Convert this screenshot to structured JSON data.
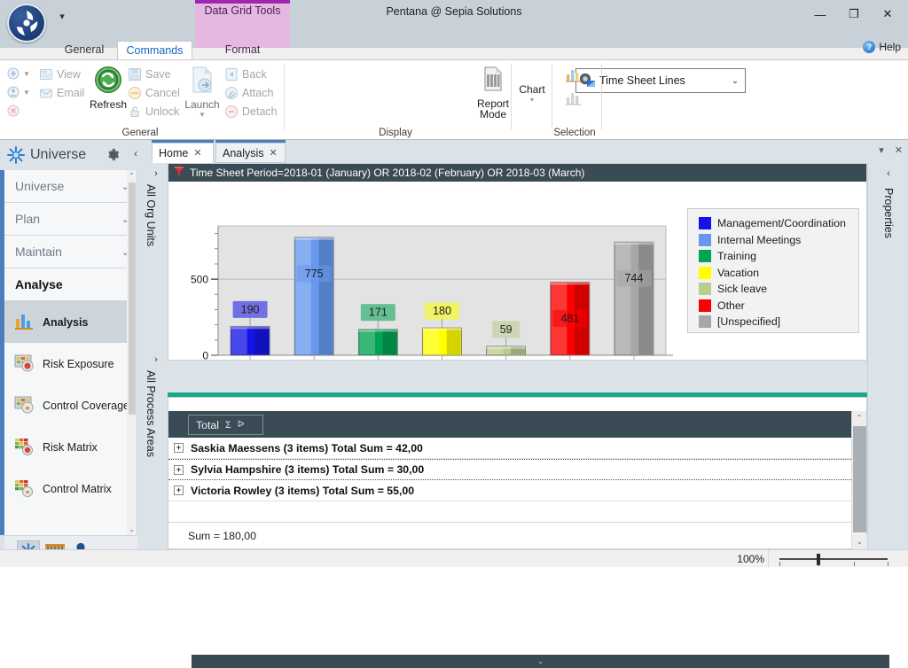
{
  "window": {
    "title": "Pentana @ Sepia Solutions",
    "minimize": "—",
    "maximize": "❐",
    "close": "✕",
    "orb_caret": "▾"
  },
  "ribbon": {
    "contextual_tab": "Data Grid Tools",
    "tabs": [
      {
        "label": "General",
        "selected": false
      },
      {
        "label": "Commands",
        "selected": true
      },
      {
        "label": "Format",
        "selected": false
      }
    ],
    "help_label": "Help",
    "groups": [
      {
        "title": "General"
      },
      {
        "title": "Display"
      },
      {
        "title": "Selection"
      }
    ],
    "general_group": {
      "view": "View",
      "email": "Email",
      "refresh": "Refresh",
      "save": "Save",
      "cancel": "Cancel",
      "unlock": "Unlock",
      "launch": "Launch",
      "back": "Back",
      "attach": "Attach",
      "detach": "Detach"
    },
    "display_group": {
      "combo_value": "Time Sheet Lines",
      "combo_caret": "⌄",
      "report_mode": "Report\nMode",
      "report_mode_line1": "Report",
      "report_mode_line2": "Mode",
      "chart": "Chart",
      "chart_caret": "▾"
    }
  },
  "sidebar": {
    "header": "Universe",
    "gear_tooltip": "Settings",
    "collapse": "‹",
    "sections": [
      {
        "label": "Universe",
        "expandable": true,
        "active": false
      },
      {
        "label": "Plan",
        "expandable": true,
        "active": false
      },
      {
        "label": "Maintain",
        "expandable": true,
        "active": false
      },
      {
        "label": "Analyse",
        "expandable": false,
        "active": true
      }
    ],
    "chevron": "⌄",
    "items": [
      {
        "label": "Analysis",
        "selected": true
      },
      {
        "label": "Risk Exposure",
        "selected": false
      },
      {
        "label": "Control Coverage",
        "selected": false
      },
      {
        "label": "Risk Matrix",
        "selected": false
      },
      {
        "label": "Control Matrix",
        "selected": false
      }
    ],
    "footer_icons": [
      "universe-icon",
      "plan-icon",
      "person-icon"
    ],
    "footer_caret": "▾",
    "scroll_up": "⌃",
    "scroll_down": "⌄"
  },
  "document": {
    "tabs": [
      {
        "label": "Home",
        "close": "✕",
        "selected": true
      },
      {
        "label": "Analysis",
        "close": "✕",
        "selected": false
      }
    ],
    "controls": {
      "pin": "▾",
      "close": "✕"
    },
    "side_tabs": [
      {
        "label": "All Org Units",
        "chevron": "›"
      },
      {
        "label": "All Process Areas",
        "chevron": "›"
      }
    ],
    "properties_rail": {
      "label": "Properties",
      "chevron": "‹"
    }
  },
  "filter_bar": {
    "icon": "filter-icon",
    "text": "Time Sheet Period=2018-01 (January) OR 2018-02 (February) OR 2018-03 (March)"
  },
  "chart_data": {
    "type": "bar",
    "title": "",
    "xlabel": "",
    "ylabel": "",
    "ylim": [
      0,
      850
    ],
    "yticks": [
      0,
      500
    ],
    "ytick_labels": [
      "0",
      "500"
    ],
    "grid": true,
    "legend_position": "right",
    "categories": [
      "Management/Coordination",
      "Internal Meetings",
      "Training",
      "Vacation",
      "Sick leave",
      "Other",
      "[Unspecified]"
    ],
    "values": [
      190,
      775,
      171,
      180,
      59,
      481,
      744
    ],
    "data_labels": [
      "190",
      "775",
      "171",
      "180",
      "59",
      "481",
      "744"
    ],
    "colors": [
      "#1414e6",
      "#6699ee",
      "#00a352",
      "#ffff00",
      "#bacd8f",
      "#fa0000",
      "#a6a6a6"
    ],
    "legend": [
      {
        "label": "Management/Coordination",
        "color": "#1414e6"
      },
      {
        "label": "Internal Meetings",
        "color": "#6699ee"
      },
      {
        "label": "Training",
        "color": "#00a352"
      },
      {
        "label": "Vacation",
        "color": "#ffff00"
      },
      {
        "label": "Sick leave",
        "color": "#bacd8f"
      },
      {
        "label": "Other",
        "color": "#fa0000"
      },
      {
        "label": "[Unspecified]",
        "color": "#a6a6a6"
      }
    ]
  },
  "grid": {
    "collapse_caret": "⌄",
    "total_chip": {
      "label": "Total",
      "sigma": "Σ",
      "filter": "ᐅ"
    },
    "rows": [
      {
        "expander": "+",
        "text": "Saskia Maessens (3 items) Total Sum = 42,00",
        "focused": false
      },
      {
        "expander": "+",
        "text": "Sylvia Hampshire (3 items) Total Sum = 30,00",
        "focused": true
      },
      {
        "expander": "+",
        "text": "Victoria Rowley (3 items) Total Sum = 55,00",
        "focused": false
      }
    ],
    "summary": "Sum = 180,00",
    "scroll_up": "⌃",
    "scroll_down": "⌄"
  },
  "status": {
    "zoom_label": "100%"
  },
  "colors": {
    "accent_blue": "#4a7ebb",
    "teal": "#17a98c",
    "dark_slate": "#3a4b55",
    "contextual_purple": "#9c27b0",
    "titlebar": "#c9d1d8"
  }
}
